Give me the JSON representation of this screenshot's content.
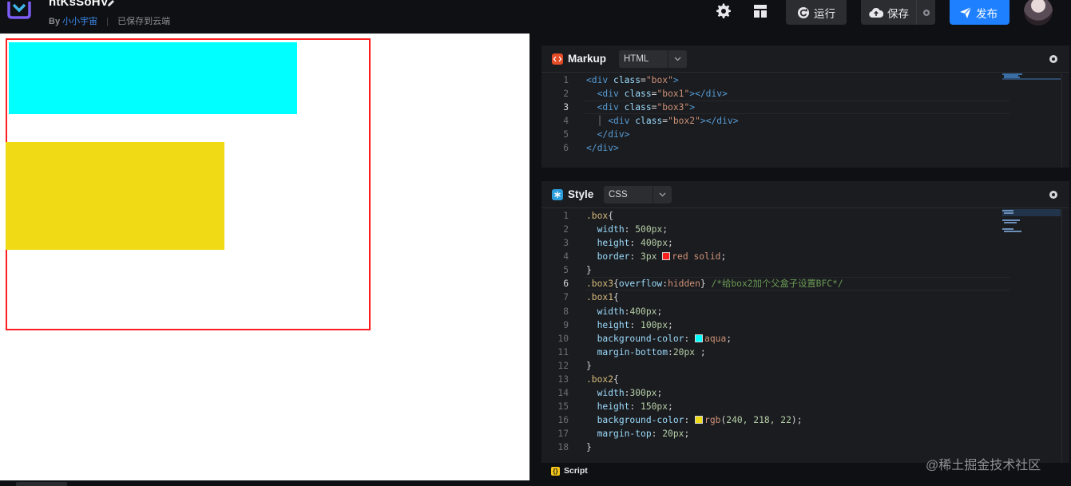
{
  "header": {
    "project_title": "htKsSoHV",
    "by_label": "By",
    "author": "小小宇宙",
    "save_status": "已保存到云端",
    "run_label": "运行",
    "save_label": "保存",
    "publish_label": "发布"
  },
  "markup_panel": {
    "title": "Markup",
    "language": "HTML",
    "lines": [
      {
        "n": "1",
        "active": false
      },
      {
        "n": "2",
        "active": false
      },
      {
        "n": "3",
        "active": true
      },
      {
        "n": "4",
        "active": false
      },
      {
        "n": "5",
        "active": false
      },
      {
        "n": "6",
        "active": false
      }
    ],
    "code": [
      {
        "indent": "",
        "tag_open": "<div",
        "attr": "class",
        "value": "\"box\"",
        "close": ">"
      },
      {
        "indent": "  ",
        "tag_open": "<div",
        "attr": "class",
        "value": "\"box1\"",
        "close": "></div>"
      },
      {
        "indent": "  ",
        "tag_open": "<div",
        "attr": "class",
        "value": "\"box3\"",
        "close": ">"
      },
      {
        "indent": "  │ ",
        "tag_open": "<div",
        "attr": "class",
        "value": "\"box2\"",
        "close": "></div>"
      },
      {
        "indent": "  ",
        "tag_only": "</div>"
      },
      {
        "indent": "",
        "tag_only": "</div>"
      }
    ]
  },
  "style_panel": {
    "title": "Style",
    "language": "CSS",
    "lines": [
      "1",
      "2",
      "3",
      "4",
      "5",
      "6",
      "7",
      "8",
      "9",
      "10",
      "11",
      "12",
      "13",
      "14",
      "15",
      "16",
      "17",
      "18"
    ],
    "active_line": "6",
    "code": {
      "l1_sel": ".box",
      "l1_brace": "{",
      "l2_prop": "width",
      "l2_val": "500px",
      "l3_prop": "height",
      "l3_val": "400px",
      "l4_prop": "border",
      "l4_num": "3px",
      "l4_val": "red solid",
      "l5": "}",
      "l6_sel": ".box3",
      "l6_body_prop": "overflow",
      "l6_body_val": "hidden",
      "l6_comment": "/*给box2加个父盒子设置BFC*/",
      "l7_sel": ".box1",
      "l7_brace": "{",
      "l8_prop": "width",
      "l8_val": "400px",
      "l9_prop": "height",
      "l9_val": "100px",
      "l10_prop": "background-color",
      "l10_val": "aqua",
      "l11_prop": "margin-bottom",
      "l11_val": "20px",
      "l12": "}",
      "l13_sel": ".box2",
      "l13_brace": "{",
      "l14_prop": "width",
      "l14_val": "300px",
      "l15_prop": "height",
      "l15_val": "150px",
      "l16_prop": "background-color",
      "l16_fn": "rgb",
      "l16_args": "240, 218, 22",
      "l17_prop": "margin-top",
      "l17_val": "20px",
      "l18": "}"
    }
  },
  "script_panel": {
    "title": "Script"
  },
  "watermark": "@稀土掘金技术社区",
  "colors": {
    "brand_blue": "#1e80ff",
    "box_border": "#ff1e1e",
    "box1": "#00ffff",
    "box2": "#f0da16"
  }
}
